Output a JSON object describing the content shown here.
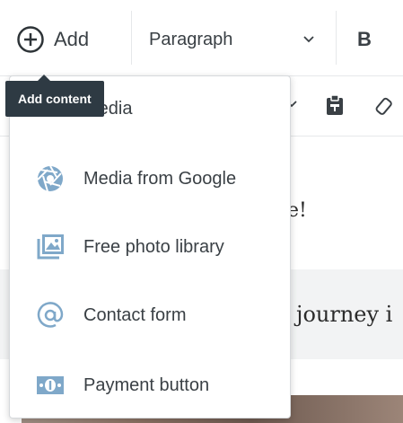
{
  "toolbar": {
    "add_label": "Add",
    "paragraph_label": "Paragraph",
    "bold_label": "B"
  },
  "tooltip": {
    "text": "Add content"
  },
  "menu": {
    "items": [
      {
        "label": "Media",
        "icon": "image-icon"
      },
      {
        "label": "Media from Google",
        "icon": "aperture-icon"
      },
      {
        "label": "Free photo library",
        "icon": "photo-library-icon"
      },
      {
        "label": "Contact form",
        "icon": "at-sign-icon"
      },
      {
        "label": "Payment button",
        "icon": "payment-icon"
      }
    ]
  },
  "content": {
    "text1": "e!",
    "text2": "journey i"
  },
  "colors": {
    "icon_blue": "#7fa8c9",
    "text": "#3a4045",
    "tooltip_bg": "#2e3a43"
  }
}
